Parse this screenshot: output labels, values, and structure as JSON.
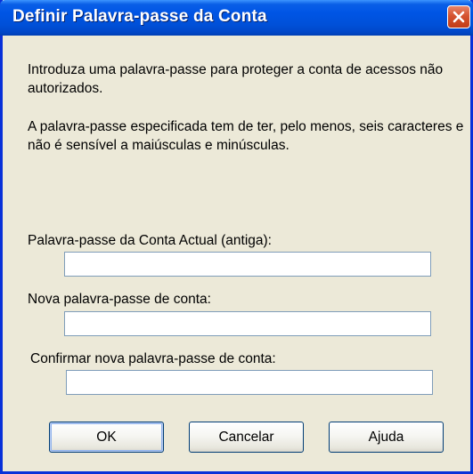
{
  "window": {
    "title": "Definir Palavra-passe da Conta",
    "close_icon": "close-icon"
  },
  "description": {
    "paragraph1": "Introduza uma palavra-passe para proteger a conta de acessos não autorizados.",
    "paragraph2": "A palavra-passe especificada tem de ter, pelo menos, seis caracteres e não é sensível a maiúsculas e minúsculas."
  },
  "fields": {
    "old_password": {
      "label": "Palavra-passe da Conta Actual (antiga):",
      "value": ""
    },
    "new_password": {
      "label": "Nova palavra-passe de conta:",
      "value": ""
    },
    "confirm_password": {
      "label": "Confirmar nova palavra-passe de conta:",
      "value": ""
    }
  },
  "buttons": {
    "ok": "OK",
    "cancel": "Cancelar",
    "help": "Ajuda"
  },
  "colors": {
    "titlebar": "#0055e5",
    "close_button": "#d5532f",
    "dialog_background": "#ece9d8",
    "field_border": "#7f9db9",
    "button_border": "#003c74"
  }
}
